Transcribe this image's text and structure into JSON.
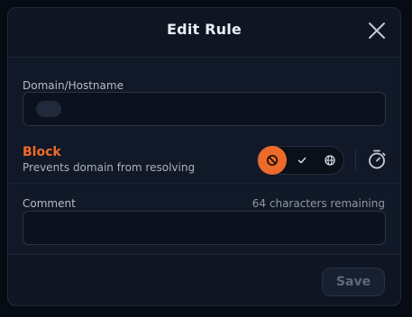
{
  "dialog": {
    "title": "Edit Rule",
    "close_icon": "close-icon"
  },
  "domain": {
    "label": "Domain/Hostname",
    "value": "",
    "placeholder": ""
  },
  "rule": {
    "action_label": "Block",
    "action_description": "Prevents domain from resolving",
    "action_color": "#f06a28",
    "options": [
      {
        "name": "block",
        "icon": "block-icon",
        "selected": true
      },
      {
        "name": "allow",
        "icon": "check-icon",
        "selected": false
      },
      {
        "name": "redirect",
        "icon": "globe-icon",
        "selected": false
      }
    ],
    "timer_icon": "timer-icon"
  },
  "comment": {
    "label": "Comment",
    "remaining_text": "64 characters remaining",
    "value": "",
    "placeholder": ""
  },
  "footer": {
    "save_label": "Save"
  }
}
